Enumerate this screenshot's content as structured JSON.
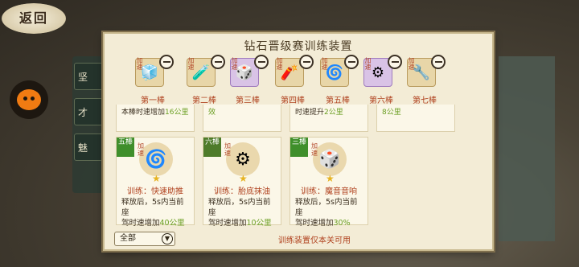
{
  "nav": {
    "back_label": "返回"
  },
  "panel": {
    "title": "钻石晋级赛训练装置",
    "footer_note": "训练装置仅本关可用"
  },
  "filter": {
    "selected": "全部"
  },
  "slots": [
    {
      "label": "第一棒",
      "tag": "加速",
      "icon": "🧊"
    },
    {
      "label": "第二棒",
      "tag": "加速",
      "icon": "🧪"
    },
    {
      "label": "第三棒",
      "tag": "加速",
      "icon": "🎲"
    },
    {
      "label": "第四棒",
      "tag": "加速",
      "icon": "🧨"
    },
    {
      "label": "第五棒",
      "tag": "加速",
      "icon": "🌀"
    },
    {
      "label": "第六棒",
      "tag": "加速",
      "icon": "⚙"
    },
    {
      "label": "第七棒",
      "tag": "加速",
      "icon": "🔧"
    }
  ],
  "top_cards": [
    {
      "text": "本棒时速增加",
      "value": "16公里"
    },
    {
      "text": "",
      "value": "效"
    },
    {
      "text": "时速提升",
      "value": "2公里"
    },
    {
      "text": "",
      "value": "8公里"
    }
  ],
  "cards": [
    {
      "ribbon": "五棒",
      "tag": "加速",
      "icon": "🌀",
      "name": "训练：快速助推",
      "desc_line1": "释放后，5s内当前座",
      "desc_line2": "驾时速增加",
      "value": "40公里"
    },
    {
      "ribbon": "六棒",
      "tag": "加速",
      "icon": "⚙",
      "name": "训练：胎底抹油",
      "desc_line1": "释放后，5s内当前座",
      "desc_line2": "驾时速增加",
      "value": "10公里"
    },
    {
      "ribbon": "三棒",
      "tag": "加速",
      "icon": "🎲",
      "name": "训练：魔音音响",
      "desc_line1": "释放后，5s内当前座",
      "desc_line2": "驾时速增加",
      "value": "30%"
    }
  ]
}
